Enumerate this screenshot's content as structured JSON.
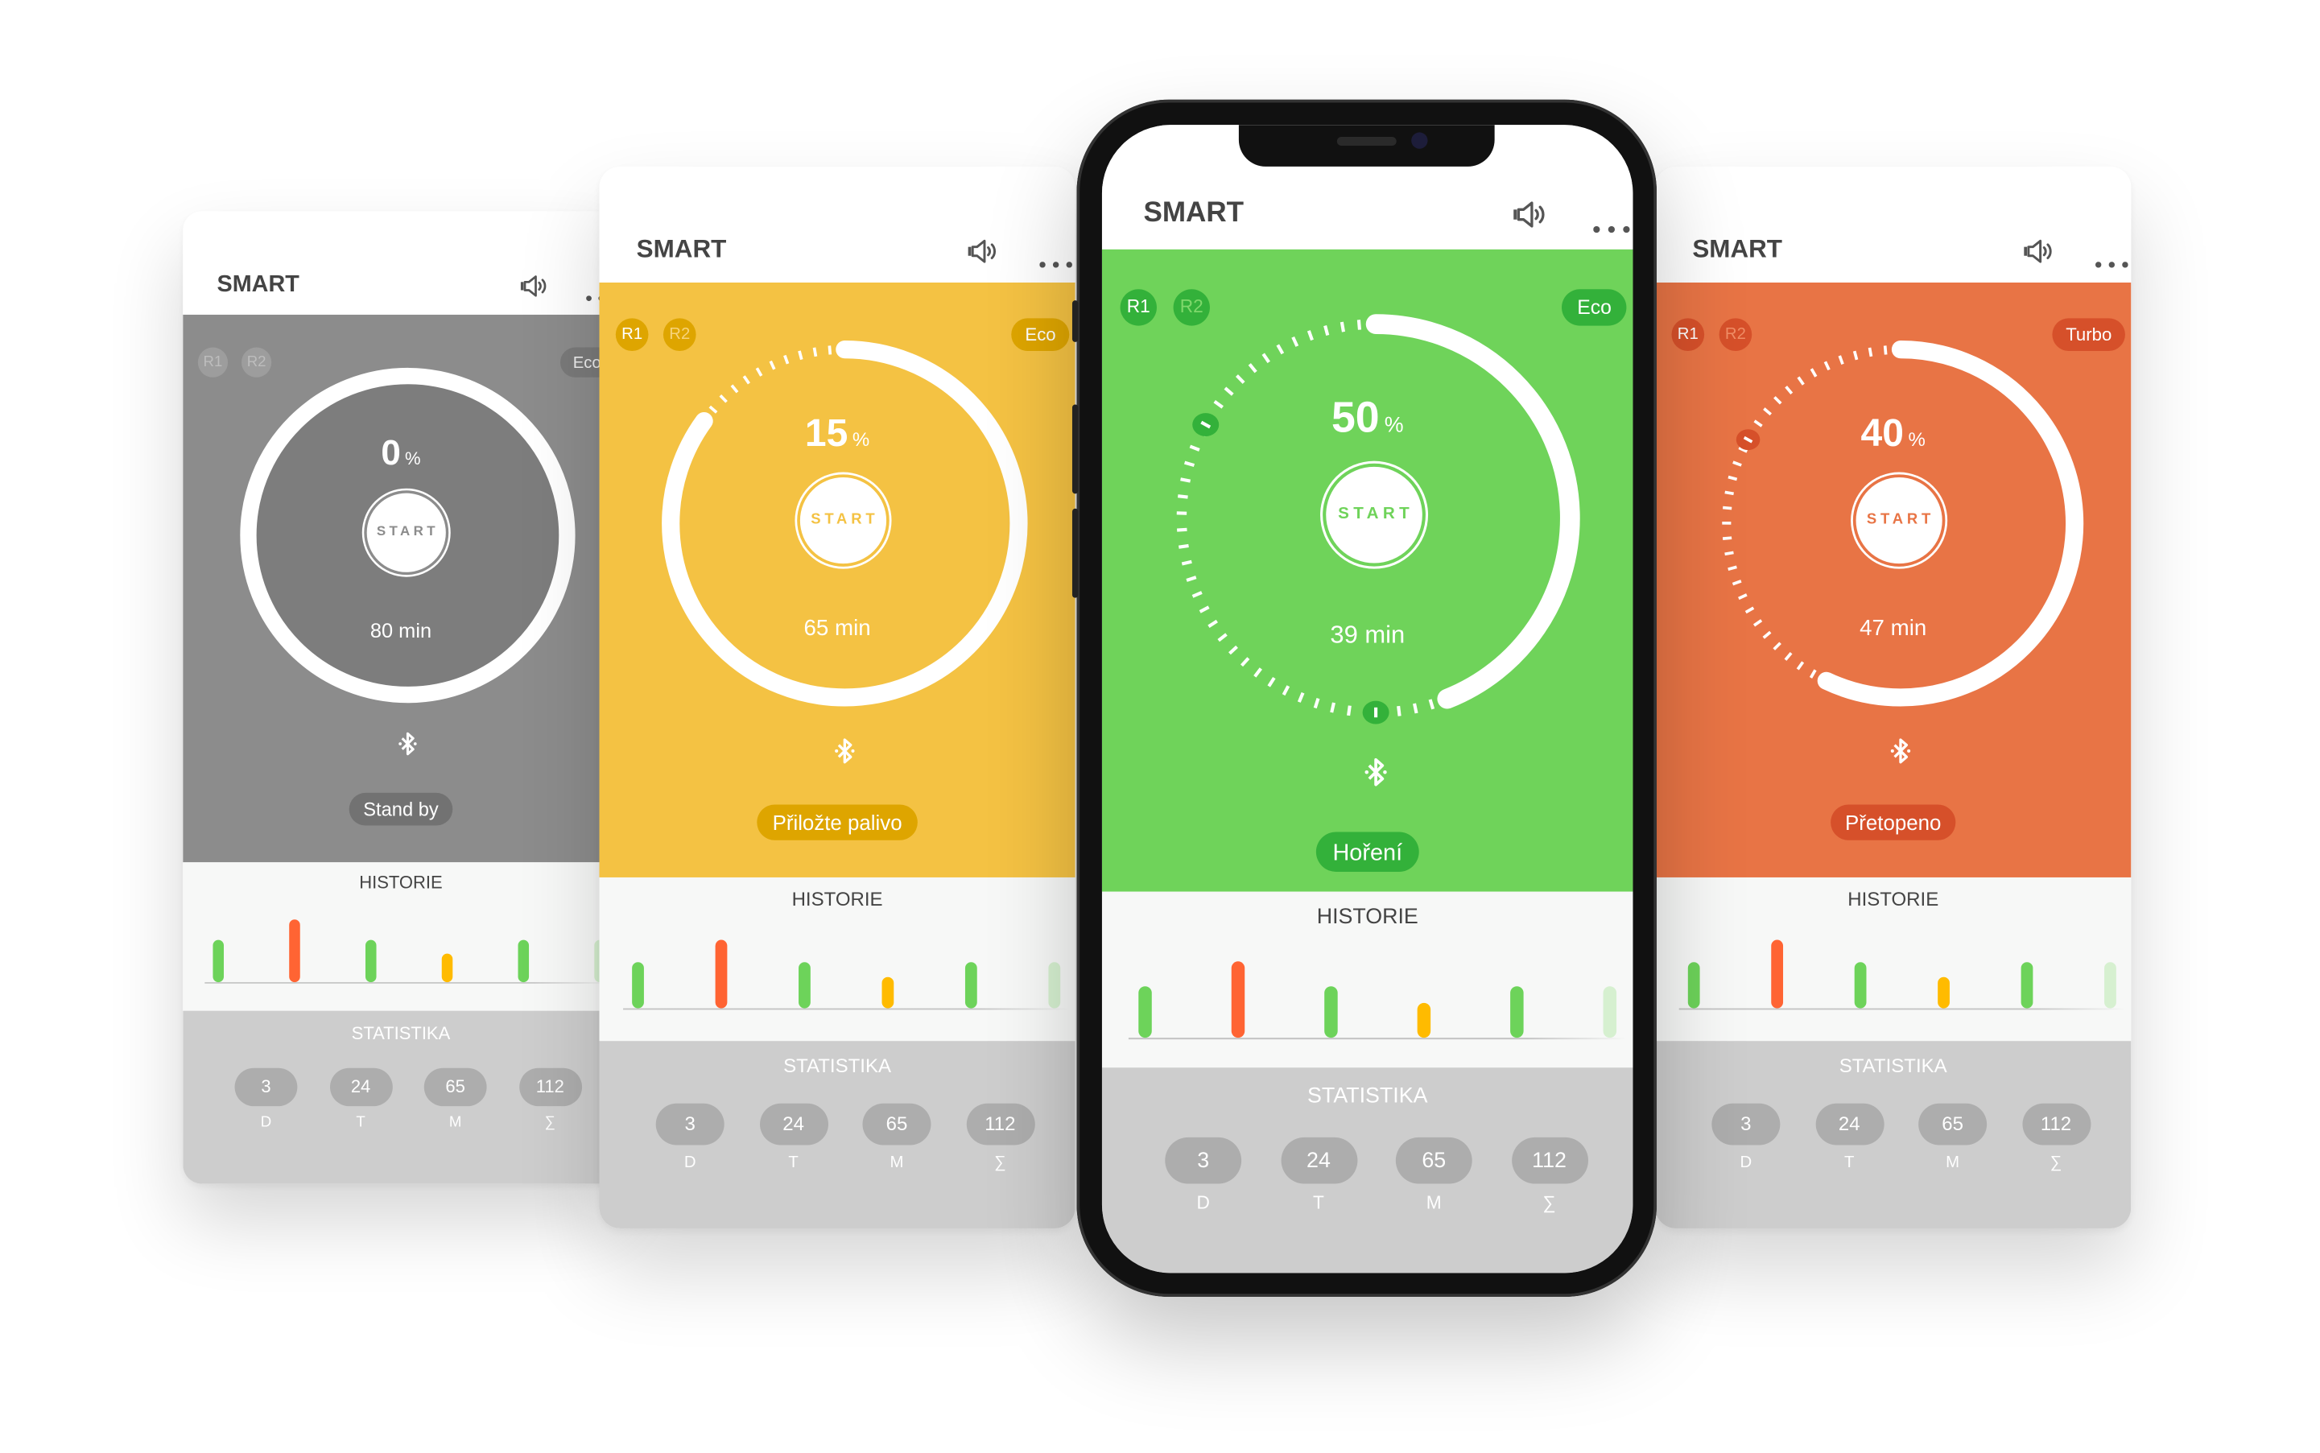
{
  "app_title": "SMART",
  "icons": {
    "sound": "speaker-icon",
    "menu": "more-dots-icon",
    "connection": "bluetooth-icon"
  },
  "screens": [
    {
      "theme_color": "#8c8c8c",
      "accent_color": "#727272",
      "dial_fill": "#7d7d7d",
      "relay_color": "#9d9d9d",
      "relay_text": "#bdbdbd",
      "percent": "0",
      "percent_unit": "%",
      "start_label": "START",
      "time": "80 min",
      "mode": "Eco",
      "status": "Stand by",
      "relays": [
        "R1",
        "R2"
      ],
      "active_relay": "",
      "arc_fraction": 1.0,
      "markers": []
    },
    {
      "theme_color": "#f4c243",
      "accent_color": "#dea500",
      "relay_color": "#dea500",
      "relay_text": "#f7d37a",
      "percent": "15",
      "percent_unit": "%",
      "start_label": "START",
      "time": "65 min",
      "mode": "Eco",
      "status": "Přiložte palivo",
      "relays": [
        "R1",
        "R2"
      ],
      "active_relay": "R1",
      "arc_fraction": 0.85,
      "markers": []
    },
    {
      "theme_color": "#6fd35a",
      "accent_color": "#33b13a",
      "relay_color": "#33b13a",
      "relay_text": "#7fd86b",
      "percent": "50",
      "percent_unit": "%",
      "start_label": "START",
      "time": "39 min",
      "mode": "Eco",
      "status": "Hoření",
      "relays": [
        "R1",
        "R2"
      ],
      "active_relay": "R1",
      "arc_fraction": 0.44,
      "markers": [
        0.5,
        0.83
      ]
    },
    {
      "theme_color": "#e87445",
      "accent_color": "#d6502a",
      "relay_color": "#d6502a",
      "relay_text": "#f08e66",
      "percent": "40",
      "percent_unit": "%",
      "start_label": "START",
      "time": "47 min",
      "mode": "Turbo",
      "status": "Přetopeno",
      "relays": [
        "R1",
        "R2"
      ],
      "active_relay": "R1",
      "arc_fraction": 0.57,
      "markers": [
        0.83
      ]
    }
  ],
  "history": {
    "title": "HISTORIE",
    "bars": [
      {
        "value": 3,
        "color": "#6dd35a"
      },
      {
        "value": 4.4,
        "color": "#ff6433"
      },
      {
        "value": 3,
        "color": "#6dd35a"
      },
      {
        "value": 2,
        "color": "#ffbb00"
      },
      {
        "value": 3,
        "color": "#6dd35a"
      },
      {
        "value": 3,
        "color": "#d6f0d0"
      }
    ]
  },
  "statistics": {
    "title": "STATISTIKA",
    "items": [
      {
        "value": "3",
        "label": "D"
      },
      {
        "value": "24",
        "label": "T"
      },
      {
        "value": "65",
        "label": "M"
      },
      {
        "value": "112",
        "label": "∑"
      }
    ]
  }
}
